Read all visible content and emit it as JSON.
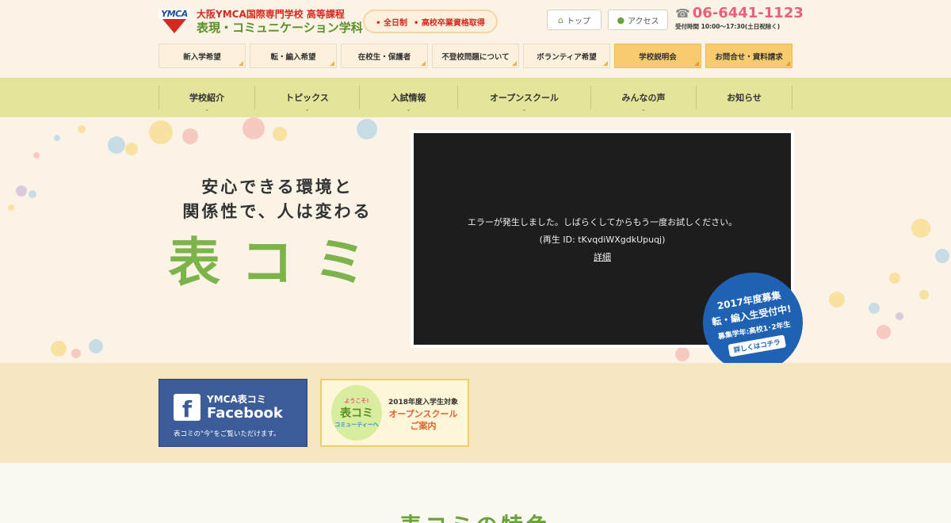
{
  "header": {
    "logo_text": "YMCA",
    "school_name": "大阪YMCA国際専門学校 高等課程",
    "dept_name": "表現・コミュニケーション学科",
    "badge_items": [
      "全日制",
      "高校卒業資格取得"
    ],
    "top_link": "トップ",
    "access_link": "アクセス",
    "phone": "06-6441-1123",
    "hours": "受付時間 10:00～17:30(土日祝除く)"
  },
  "subnav": [
    {
      "label": "新入学希望"
    },
    {
      "label": "転・編入希望"
    },
    {
      "label": "在校生・保護者"
    },
    {
      "label": "不登校問題について"
    },
    {
      "label": "ボランティア希望"
    },
    {
      "label": "学校説明会"
    },
    {
      "label": "お問合せ・資料請求"
    }
  ],
  "mainnav": [
    {
      "label": "学校紹介"
    },
    {
      "label": "トピックス"
    },
    {
      "label": "入試情報"
    },
    {
      "label": "オープンスクール"
    },
    {
      "label": "みんなの声"
    },
    {
      "label": "お知らせ"
    }
  ],
  "hero": {
    "tagline_line1": "安心できる環境と",
    "tagline_line2": "関係性で、人は変わる",
    "big_title": "表コミ",
    "video_error": "エラーが発生しました。しばらくしてからもう一度お試しください。",
    "video_id": "(再生 ID: tKvqdiWXgdkUpuqj)",
    "video_details": "詳細",
    "badge": {
      "line1": "2017年度募集",
      "line2": "転・編入生受付中!",
      "line3": "募集学年:高校1･2年生",
      "cta": "詳しくはコチラ"
    }
  },
  "banners": {
    "facebook": {
      "line1": "YMCA表コミ",
      "line2": "Facebook",
      "line3": "表コミの\"今\"をご覧いただけます。"
    },
    "open_campus": {
      "circle_top": "ようこそ!",
      "circle_mid": "表コミ",
      "circle_bottom": "コミューティーへ",
      "line1": "2018年度入学生対象",
      "line2": "オープンスクール",
      "line3": "ご案内"
    }
  },
  "features": {
    "title": "表コミの特色"
  },
  "colors": {
    "accent_green": "#7db34b",
    "nav_bg": "#e4e59a",
    "phone_pink": "#e8607a",
    "badge_blue": "#1f62b4",
    "facebook_blue": "#3b5c99"
  }
}
